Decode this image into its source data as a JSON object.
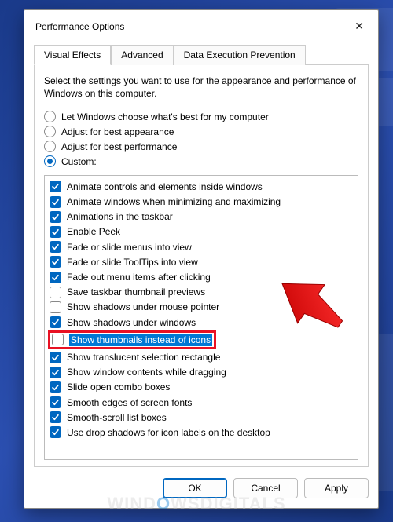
{
  "window": {
    "title": "Performance Options"
  },
  "tabs": [
    {
      "label": "Visual Effects"
    },
    {
      "label": "Advanced"
    },
    {
      "label": "Data Execution Prevention"
    }
  ],
  "description": "Select the settings you want to use for the appearance and performance of Windows on this computer.",
  "radios": [
    {
      "label": "Let Windows choose what's best for my computer",
      "checked": false
    },
    {
      "label": "Adjust for best appearance",
      "checked": false
    },
    {
      "label": "Adjust for best performance",
      "checked": false
    },
    {
      "label": "Custom:",
      "checked": true
    }
  ],
  "options": [
    {
      "label": "Animate controls and elements inside windows",
      "checked": true
    },
    {
      "label": "Animate windows when minimizing and maximizing",
      "checked": true
    },
    {
      "label": "Animations in the taskbar",
      "checked": true
    },
    {
      "label": "Enable Peek",
      "checked": true
    },
    {
      "label": "Fade or slide menus into view",
      "checked": true
    },
    {
      "label": "Fade or slide ToolTips into view",
      "checked": true
    },
    {
      "label": "Fade out menu items after clicking",
      "checked": true
    },
    {
      "label": "Save taskbar thumbnail previews",
      "checked": false
    },
    {
      "label": "Show shadows under mouse pointer",
      "checked": false
    },
    {
      "label": "Show shadows under windows",
      "checked": true
    },
    {
      "label": "Show thumbnails instead of icons",
      "checked": false,
      "selected": true,
      "highlighted": true
    },
    {
      "label": "Show translucent selection rectangle",
      "checked": true
    },
    {
      "label": "Show window contents while dragging",
      "checked": true
    },
    {
      "label": "Slide open combo boxes",
      "checked": true
    },
    {
      "label": "Smooth edges of screen fonts",
      "checked": true
    },
    {
      "label": "Smooth-scroll list boxes",
      "checked": true
    },
    {
      "label": "Use drop shadows for icon labels on the desktop",
      "checked": true
    }
  ],
  "buttons": {
    "ok": "OK",
    "cancel": "Cancel",
    "apply": "Apply"
  },
  "watermark": {
    "part1": "WIND",
    "part2": "O",
    "part3": "WSDIGITALS"
  }
}
